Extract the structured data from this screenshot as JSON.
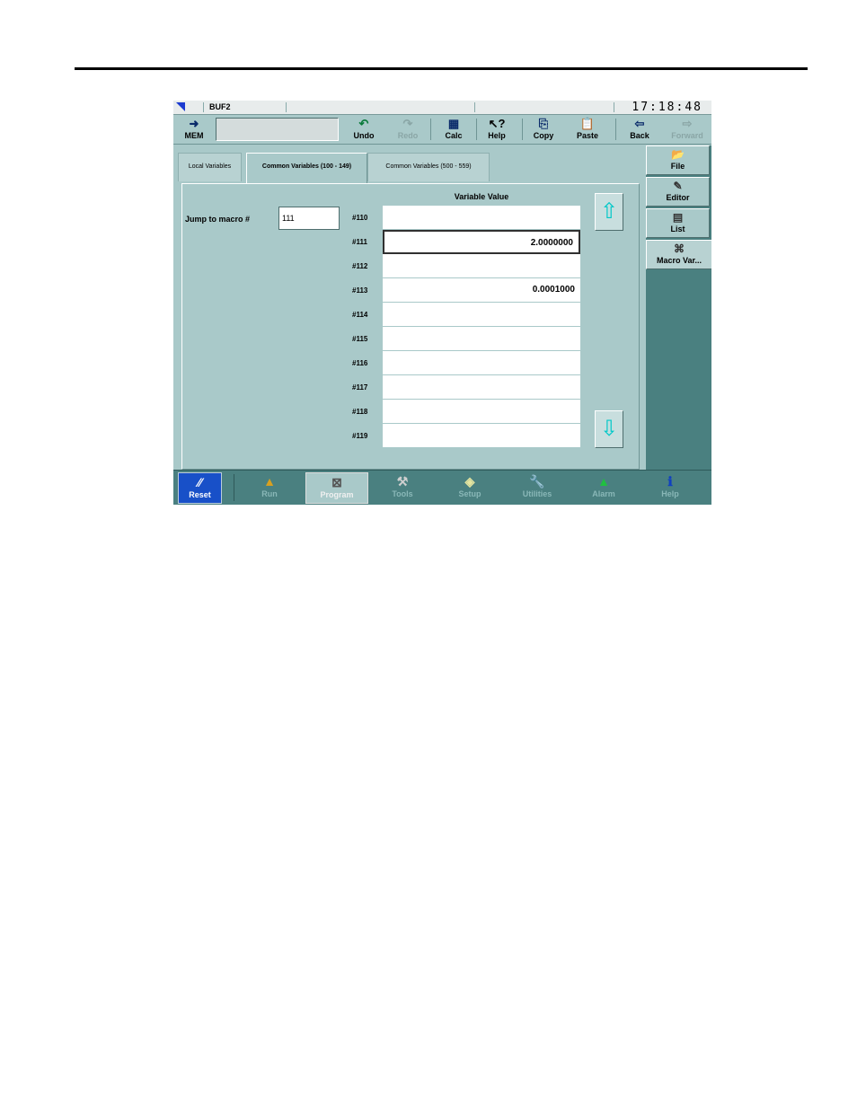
{
  "titlebar": {
    "buffer": "BUF2",
    "clock": "17:18:48"
  },
  "toolbar": {
    "mem": "MEM",
    "undo": "Undo",
    "redo": "Redo",
    "calc": "Calc",
    "help": "Help",
    "copy": "Copy",
    "paste": "Paste",
    "back": "Back",
    "forward": "Forward"
  },
  "tabs": [
    {
      "label": "Local Variables"
    },
    {
      "label": "Common Variables (100 - 149)"
    },
    {
      "label": "Common Variables (500 - 559)"
    }
  ],
  "jump": {
    "label": "Jump to macro #",
    "value": "111"
  },
  "table": {
    "header": "Variable Value",
    "rows": [
      {
        "name": "#110",
        "value": ""
      },
      {
        "name": "#111",
        "value": "2.0000000"
      },
      {
        "name": "#112",
        "value": ""
      },
      {
        "name": "#113",
        "value": "0.0001000"
      },
      {
        "name": "#114",
        "value": ""
      },
      {
        "name": "#115",
        "value": ""
      },
      {
        "name": "#116",
        "value": ""
      },
      {
        "name": "#117",
        "value": ""
      },
      {
        "name": "#118",
        "value": ""
      },
      {
        "name": "#119",
        "value": ""
      }
    ]
  },
  "sidebar": {
    "file": "File",
    "editor": "Editor",
    "list": "List",
    "macro": "Macro Var..."
  },
  "bottom": {
    "reset": "Reset",
    "run": "Run",
    "program": "Program",
    "tools": "Tools",
    "setup": "Setup",
    "utilities": "Utilities",
    "alarm": "Alarm",
    "help": "Help"
  }
}
